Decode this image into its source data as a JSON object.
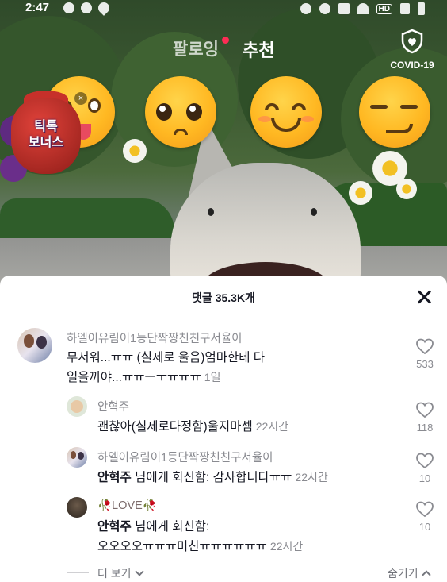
{
  "status_bar": {
    "time": "2:47",
    "hd": "HD"
  },
  "top_tabs": {
    "following": "팔로잉",
    "for_you": "추천",
    "covid_label": "COVID-19"
  },
  "bonus_badge": {
    "label_line1": "틱톡",
    "label_line2": "보너스",
    "close": "×"
  },
  "comments_sheet": {
    "header": "댓글 35.3K개",
    "comments": [
      {
        "username": "하엘이유림이1등단짝짱친친구서율이",
        "text_line1": "무서워...ㅠㅠ (실제로 울음)엄마한테 다",
        "text_line2": "일을꺼야...ㅠㅠㅡㅜㅠㅠㅠ",
        "time": "1일",
        "likes": "533"
      },
      {
        "username": "안혁주",
        "text": "괜찮아(실제로다정함)울지마셈",
        "time": "22시간",
        "likes": "118"
      },
      {
        "username": "하엘이유림이1등단짝짱친친구서율이",
        "reply_to": "안혁주",
        "text": "님에게 회신함: 감사합니다ㅠㅠ",
        "time": "22시간",
        "likes": "10"
      },
      {
        "username": "🥀LOVE🥀",
        "reply_to": "안혁주",
        "text_line1": "님에게 회신함:",
        "text_line2": "오오오오ㅠㅠㅠ미친ㅠㅠㅠㅠㅠㅠ",
        "time": "22시간",
        "likes": "10"
      }
    ],
    "view_more": "더 보기",
    "hide": "숨기기"
  }
}
